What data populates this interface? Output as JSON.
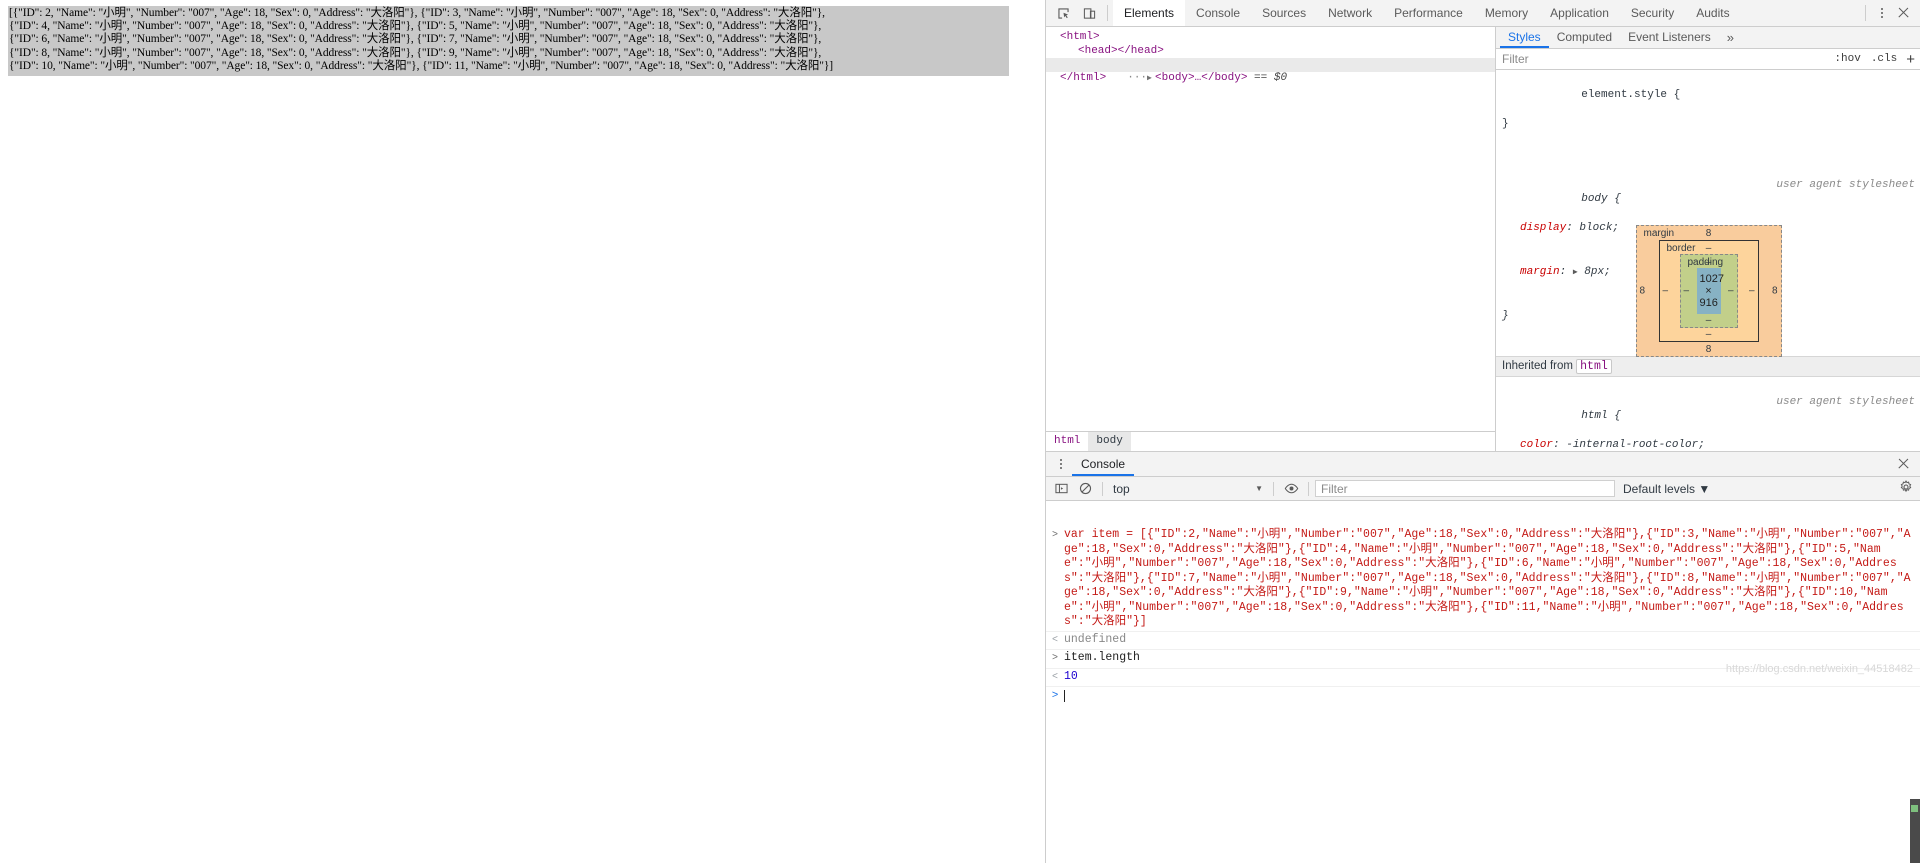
{
  "page": {
    "json_dump_lines": [
      "[{\"ID\": 2, \"Name\": \"小明\", \"Number\": \"007\", \"Age\": 18, \"Sex\": 0, \"Address\": \"大洛阳\"}, {\"ID\": 3, \"Name\": \"小明\", \"Number\": \"007\", \"Age\": 18, \"Sex\": 0, \"Address\": \"大洛阳\"},",
      "{\"ID\": 4, \"Name\": \"小明\", \"Number\": \"007\", \"Age\": 18, \"Sex\": 0, \"Address\": \"大洛阳\"}, {\"ID\": 5, \"Name\": \"小明\", \"Number\": \"007\", \"Age\": 18, \"Sex\": 0, \"Address\": \"大洛阳\"},",
      "{\"ID\": 6, \"Name\": \"小明\", \"Number\": \"007\", \"Age\": 18, \"Sex\": 0, \"Address\": \"大洛阳\"}, {\"ID\": 7, \"Name\": \"小明\", \"Number\": \"007\", \"Age\": 18, \"Sex\": 0, \"Address\": \"大洛阳\"},",
      "{\"ID\": 8, \"Name\": \"小明\", \"Number\": \"007\", \"Age\": 18, \"Sex\": 0, \"Address\": \"大洛阳\"}, {\"ID\": 9, \"Name\": \"小明\", \"Number\": \"007\", \"Age\": 18, \"Sex\": 0, \"Address\": \"大洛阳\"},",
      "{\"ID\": 10, \"Name\": \"小明\", \"Number\": \"007\", \"Age\": 18, \"Sex\": 0, \"Address\": \"大洛阳\"}, {\"ID\": 11, \"Name\": \"小明\", \"Number\": \"007\", \"Age\": 18, \"Sex\": 0, \"Address\": \"大洛阳\"}]"
    ]
  },
  "devtools": {
    "tabs": [
      {
        "label": "Elements",
        "active": true
      },
      {
        "label": "Console",
        "active": false
      },
      {
        "label": "Sources",
        "active": false
      },
      {
        "label": "Network",
        "active": false
      },
      {
        "label": "Performance",
        "active": false
      },
      {
        "label": "Memory",
        "active": false
      },
      {
        "label": "Application",
        "active": false
      },
      {
        "label": "Security",
        "active": false
      },
      {
        "label": "Audits",
        "active": false
      }
    ],
    "icons": {
      "inspect": "inspect-element-icon",
      "device": "device-toolbar-icon",
      "more": "more-options-icon",
      "close": "close-devtools-icon"
    }
  },
  "elements": {
    "dom": [
      {
        "indent": 0,
        "text": "<html>",
        "selected": false,
        "twisty": ""
      },
      {
        "indent": 1,
        "text": "<head></head>",
        "selected": false,
        "twisty": ""
      },
      {
        "indent": 1,
        "text": "<body>…</body>",
        "selected": true,
        "twisty": "▶",
        "suffix": " == $0",
        "dots": "···"
      },
      {
        "indent": 0,
        "text": "</html>",
        "selected": false,
        "twisty": ""
      }
    ],
    "breadcrumbs": [
      {
        "label": "html",
        "selected": false
      },
      {
        "label": "body",
        "selected": true
      }
    ]
  },
  "styles": {
    "tabs": [
      {
        "label": "Styles",
        "active": true
      },
      {
        "label": "Computed",
        "active": false
      },
      {
        "label": "Event Listeners",
        "active": false
      }
    ],
    "more_glyph": "»",
    "filter_placeholder": "Filter",
    "hov_label": ":hov",
    "cls_label": ".cls",
    "plus_label": "+",
    "rules": [
      {
        "selector": "element.style {",
        "source": "",
        "declarations": [],
        "close": "}"
      },
      {
        "selector": "body {",
        "source": "user agent stylesheet",
        "declarations": [
          {
            "prop": "display",
            "value": "block;",
            "expandable": false
          },
          {
            "prop": "margin",
            "value": "8px;",
            "expandable": true
          }
        ],
        "close": "}"
      }
    ],
    "inherited_label": "Inherited from",
    "inherited_tag": "html",
    "inherited_rule": {
      "selector": "html {",
      "source": "user agent stylesheet",
      "declarations": [
        {
          "prop": "color",
          "value": "-internal-root-color;",
          "expandable": false
        }
      ],
      "close": "}"
    },
    "box_model": {
      "margin_label": "margin",
      "border_label": "border",
      "padding_label": "padding",
      "content": "1027 × 916",
      "margin": {
        "top": "8",
        "right": "8",
        "bottom": "8",
        "left": "8"
      },
      "border": {
        "top": "–",
        "right": "–",
        "bottom": "–",
        "left": "–"
      },
      "padding": {
        "top": "–",
        "right": "–",
        "bottom": "–",
        "left": "–"
      },
      "colors": {
        "margin": "#f9cc9d",
        "border": "#fdd49c",
        "padding": "#c2cf8a",
        "content": "#87b2c4"
      }
    }
  },
  "drawer": {
    "tab_label": "Console",
    "menu_icon": "drawer-menu-icon",
    "close_icon": "close-drawer-icon",
    "toolbar": {
      "sidebar_icon": "console-sidebar-icon",
      "clear_icon": "clear-console-icon",
      "context": "top",
      "eye_icon": "live-expression-icon",
      "filter_placeholder": "Filter",
      "levels": "Default levels",
      "settings_icon": "console-settings-icon"
    },
    "messages": [
      {
        "gutter": ">",
        "type": "input",
        "text": "var item = [{\"ID\":2,\"Name\":\"小明\",\"Number\":\"007\",\"Age\":18,\"Sex\":0,\"Address\":\"大洛阳\"},{\"ID\":3,\"Name\":\"小明\",\"Number\":\"007\",\"Age\":18,\"Sex\":0,\"Address\":\"大洛阳\"},{\"ID\":4,\"Name\":\"小明\",\"Number\":\"007\",\"Age\":18,\"Sex\":0,\"Address\":\"大洛阳\"},{\"ID\":5,\"Name\":\"小明\",\"Number\":\"007\",\"Age\":18,\"Sex\":0,\"Address\":\"大洛阳\"},{\"ID\":6,\"Name\":\"小明\",\"Number\":\"007\",\"Age\":18,\"Sex\":0,\"Address\":\"大洛阳\"},{\"ID\":7,\"Name\":\"小明\",\"Number\":\"007\",\"Age\":18,\"Sex\":0,\"Address\":\"大洛阳\"},{\"ID\":8,\"Name\":\"小明\",\"Number\":\"007\",\"Age\":18,\"Sex\":0,\"Address\":\"大洛阳\"},{\"ID\":9,\"Name\":\"小明\",\"Number\":\"007\",\"Age\":18,\"Sex\":0,\"Address\":\"大洛阳\"},{\"ID\":10,\"Name\":\"小明\",\"Number\":\"007\",\"Age\":18,\"Sex\":0,\"Address\":\"大洛阳\"},{\"ID\":11,\"Name\":\"小明\",\"Number\":\"007\",\"Age\":18,\"Sex\":0,\"Address\":\"大洛阳\"}]"
      },
      {
        "gutter": "<",
        "type": "undefined",
        "text": "undefined"
      },
      {
        "gutter": ">",
        "type": "input",
        "text": "item.length"
      },
      {
        "gutter": "<",
        "type": "number",
        "text": "10"
      }
    ],
    "prompt": {
      "caret": ">",
      "value": ""
    }
  },
  "watermark": "https://blog.csdn.net/weixin_44518482"
}
